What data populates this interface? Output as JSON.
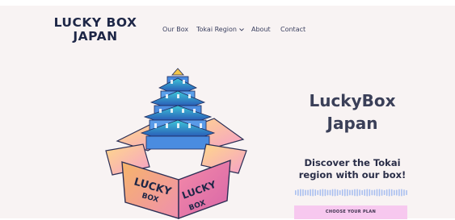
{
  "header": {
    "logo_line1": "LUCKY BOX",
    "logo_line2": "JAPAN",
    "nav": [
      {
        "label": "Our Box"
      },
      {
        "label": "Tokai Region"
      },
      {
        "label": "About"
      },
      {
        "label": "Contact"
      }
    ]
  },
  "hero": {
    "title_line1": "LuckyBox",
    "title_line2": "Japan",
    "subtitle_line1": "Discover the Tokai",
    "subtitle_line2": "region with our box!",
    "cta_label": "CHOOSE YOUR PLAN",
    "illustration": {
      "box_text_1": "LUCKY",
      "box_text_2": "BOX",
      "box_text_3": "LUCKY",
      "box_text_4": "BOX"
    }
  },
  "colors": {
    "page_bg": "#f8f3f3",
    "logo": "#1e2747",
    "cta_bg": "#f7c8ef",
    "wave": "#a9bff0"
  }
}
